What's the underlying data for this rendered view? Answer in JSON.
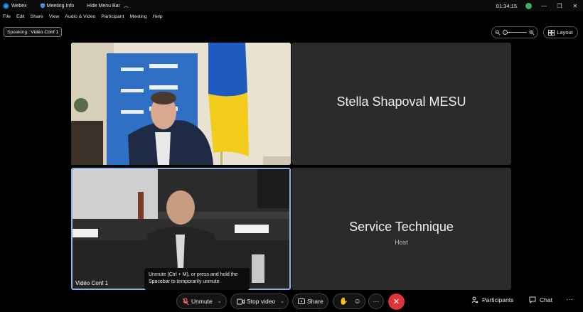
{
  "titlebar": {
    "app_name": "Webex",
    "meeting_info": "Meeting Info",
    "hide_menu": "Hide Menu Bar",
    "clock": "01:34:15"
  },
  "menu": [
    "File",
    "Edit",
    "Share",
    "View",
    "Audio & Video",
    "Participant",
    "Meeting",
    "Help"
  ],
  "speaking": {
    "label": "Speaking:",
    "name": "Vidéo Conf 1"
  },
  "layout_label": "Layout",
  "tiles": {
    "top_right": {
      "name": "Stella Shapoval MESU"
    },
    "bottom_right": {
      "name": "Service Technique",
      "role": "Host"
    },
    "bottom_left": {
      "name": "Vidéo Conf 1"
    }
  },
  "tooltip": "Unmute (Ctrl + M), or press and hold the Spacebar to temporarily unmute",
  "toolbar": {
    "unmute": "Unmute",
    "stop_video": "Stop video",
    "share": "Share",
    "participants": "Participants",
    "chat": "Chat",
    "more": "···"
  },
  "colors": {
    "end_call": "#e0343b",
    "active_border": "#8ab4e4",
    "status_green": "#3fae5b"
  }
}
